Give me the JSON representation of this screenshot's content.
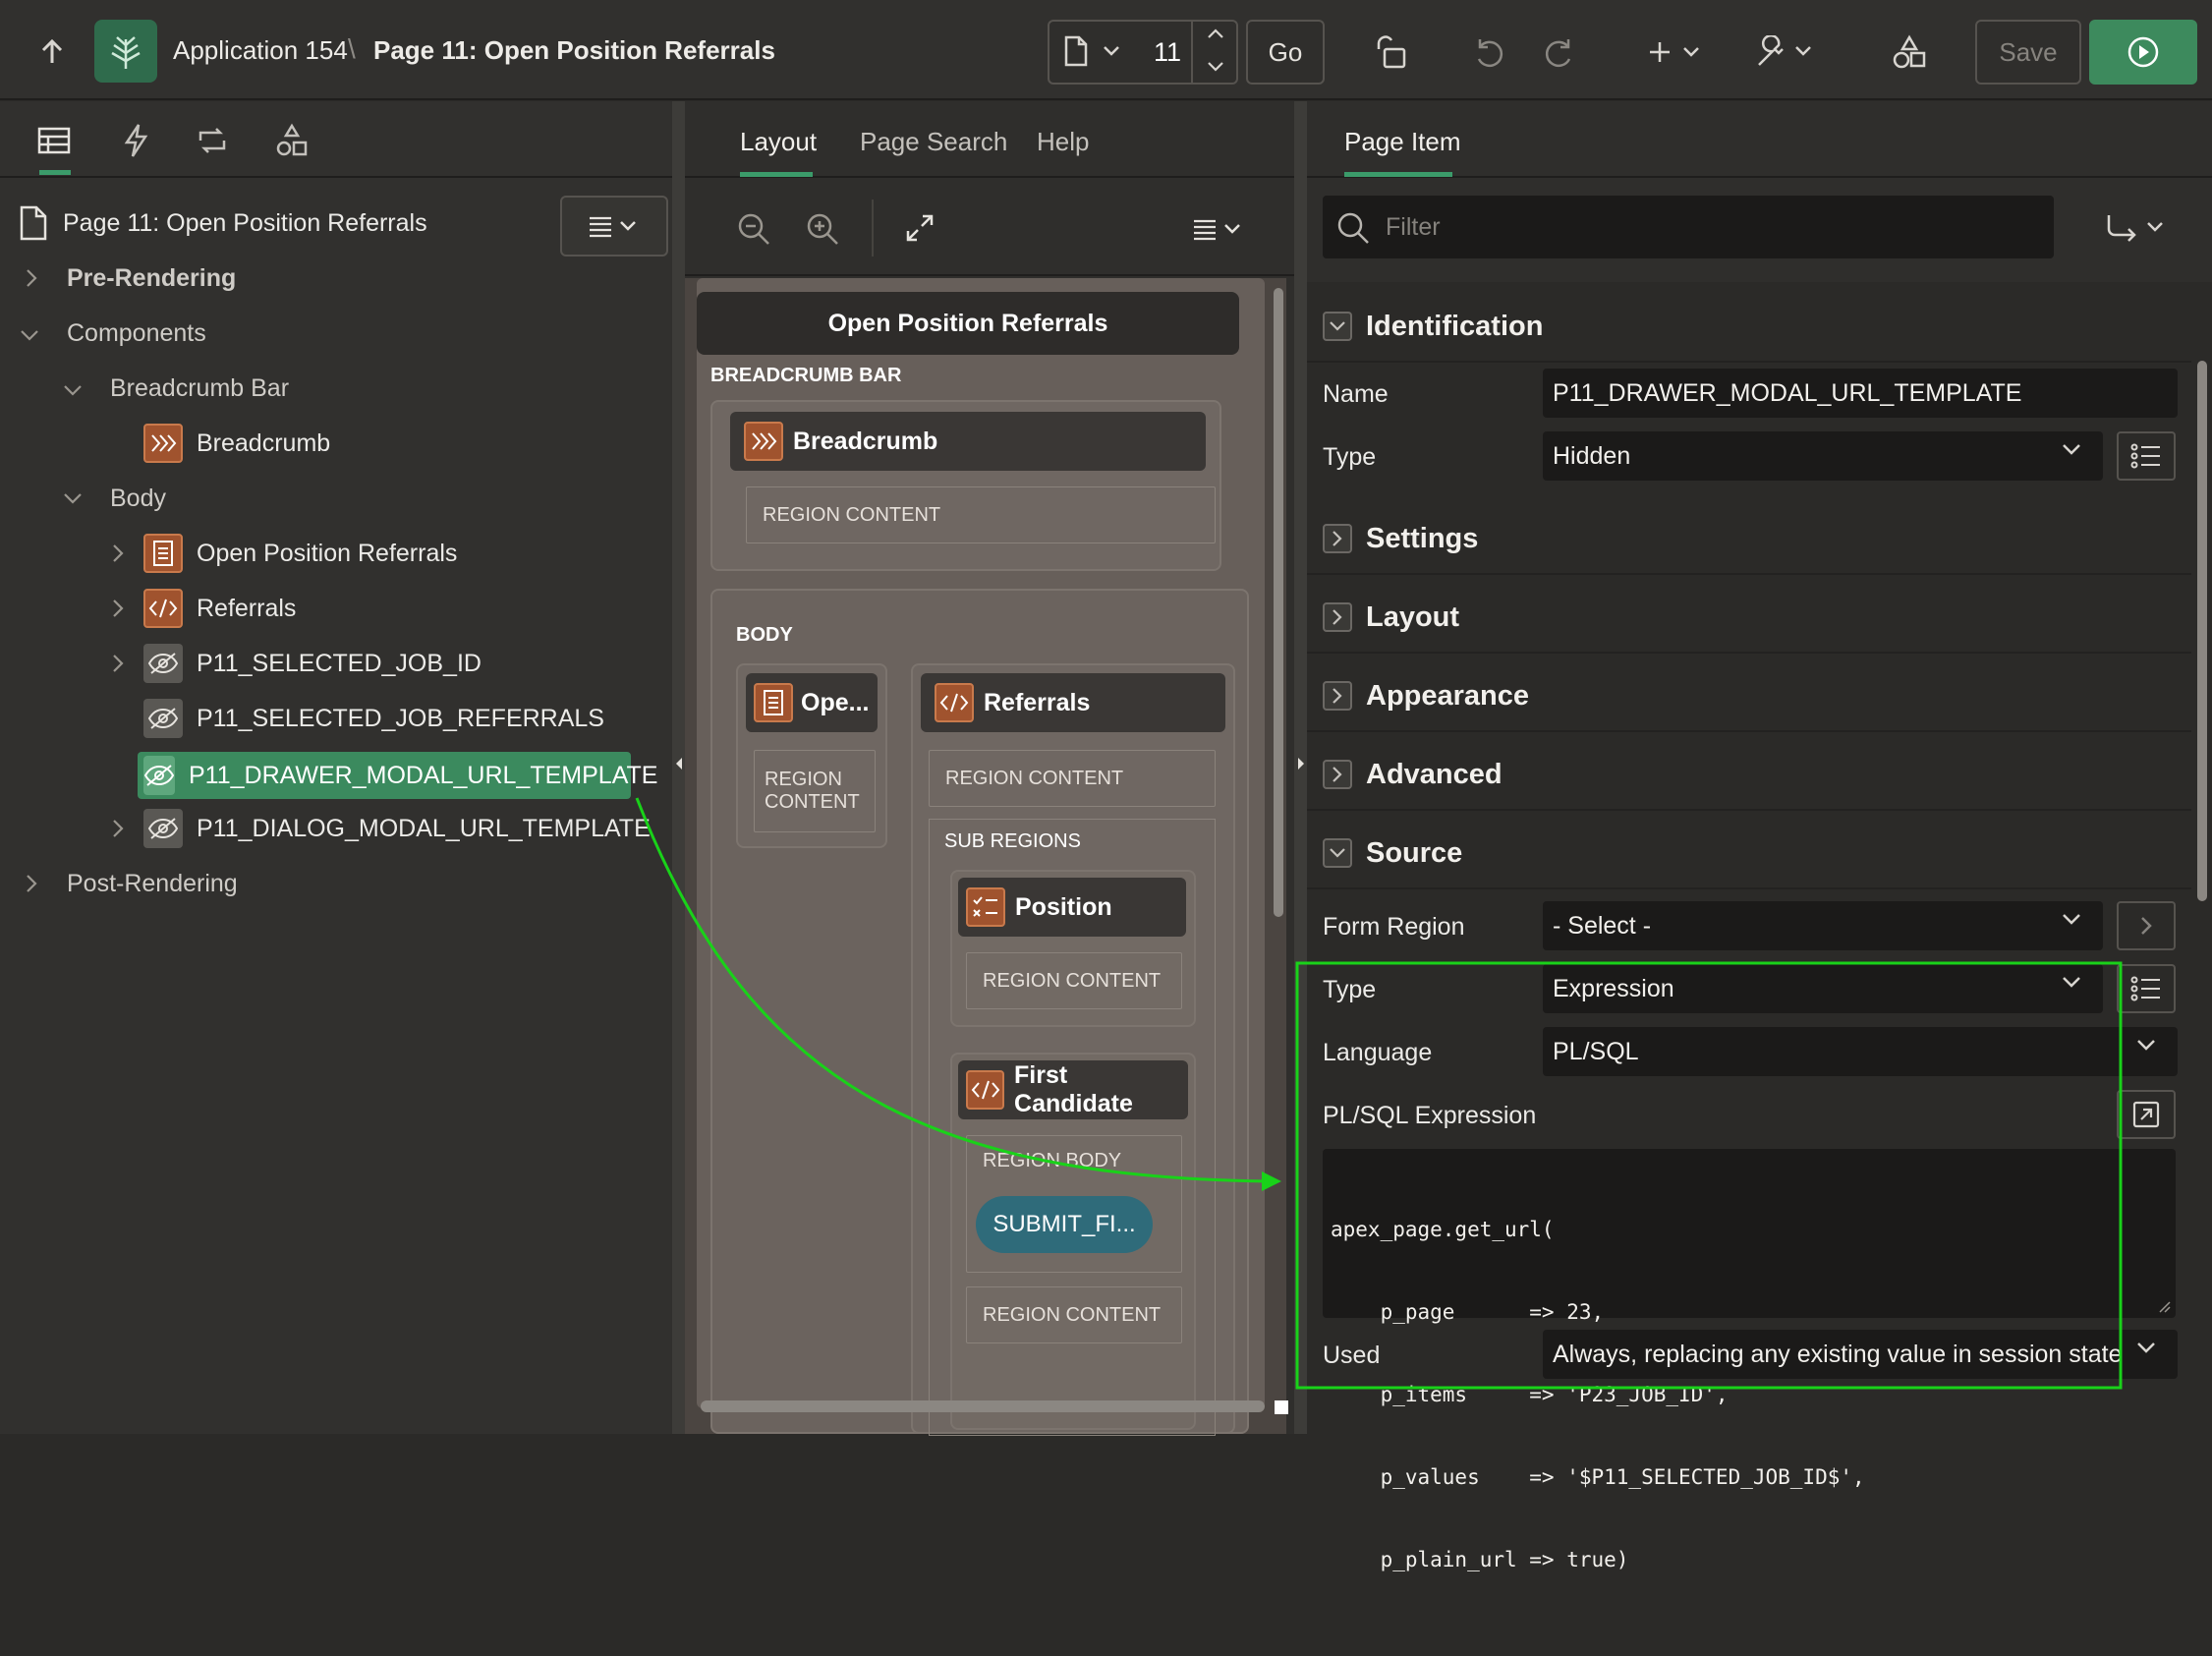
{
  "header": {
    "app_name": "Application 154",
    "separator": "\\",
    "page_title": "Page 11: Open Position Referrals",
    "page_number": "11",
    "go_label": "Go",
    "save_label": "Save"
  },
  "left": {
    "page_node": "Page 11: Open Position Referrals",
    "tree": {
      "pre_rendering": "Pre-Rendering",
      "components": "Components",
      "breadcrumb_bar": "Breadcrumb Bar",
      "breadcrumb": "Breadcrumb",
      "body": "Body",
      "open_position_referrals": "Open Position Referrals",
      "referrals": "Referrals",
      "item1": "P11_SELECTED_JOB_ID",
      "item2": "P11_SELECTED_JOB_REFERRALS",
      "item3": "P11_DRAWER_MODAL_URL_TEMPLATE",
      "item4": "P11_DIALOG_MODAL_URL_TEMPLATE",
      "post_rendering": "Post-Rendering"
    }
  },
  "mid": {
    "tabs": [
      "Layout",
      "Page Search",
      "Help"
    ],
    "page_region_title": "Open Position Referrals",
    "breadcrumb_bar_label": "BREADCRUMB BAR",
    "breadcrumb_region": "Breadcrumb",
    "region_content": "REGION CONTENT",
    "region_content_wrapped_1": "REGION",
    "region_content_wrapped_2": "CONTENT",
    "body_label": "BODY",
    "open_region": "Ope...",
    "referrals_region": "Referrals",
    "sub_regions": "SUB REGIONS",
    "position_region": "Position",
    "first_candidate_region": "First Candidate",
    "region_body": "REGION BODY",
    "submit_button": "SUBMIT_FI..."
  },
  "right": {
    "tab": "Page Item",
    "filter_placeholder": "Filter",
    "sections": {
      "identification": "Identification",
      "settings": "Settings",
      "layout": "Layout",
      "appearance": "Appearance",
      "advanced": "Advanced",
      "source": "Source"
    },
    "identification": {
      "name_label": "Name",
      "name_value": "P11_DRAWER_MODAL_URL_TEMPLATE",
      "type_label": "Type",
      "type_value": "Hidden"
    },
    "source": {
      "form_region_label": "Form Region",
      "form_region_value": "- Select -",
      "type_label": "Type",
      "type_value": "Expression",
      "language_label": "Language",
      "language_value": "PL/SQL",
      "expr_label": "PL/SQL Expression",
      "code_lines": [
        "apex_page.get_url(",
        "    p_page      => 23,",
        "    p_items     => 'P23_JOB_ID',",
        "    p_values    => '$P11_SELECTED_JOB_ID$',",
        "    p_plain_url => true)"
      ],
      "used_label": "Used",
      "used_value": "Always, replacing any existing value in session state"
    }
  },
  "colors": {
    "accent_green": "#3b9b6a",
    "highlight_green": "#19d219",
    "region_orange": "#a0532e",
    "run_button": "#3d8a5d"
  }
}
